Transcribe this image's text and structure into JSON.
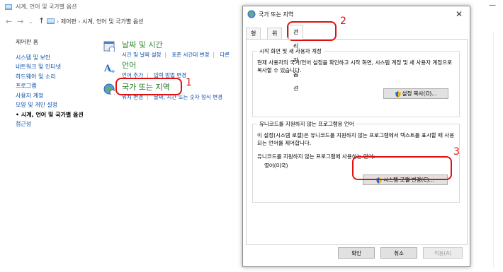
{
  "window_title": "시계, 언어 및 국가별 옵션",
  "breadcrumb": [
    "제어판",
    "시계, 언어 및 국가별 옵션"
  ],
  "sidebar": {
    "home": "제어판 홈",
    "items": [
      "시스템 및 보안",
      "네트워크 및 인터넷",
      "하드웨어 및 소리",
      "프로그램",
      "사용자 계정",
      "모양 및 개인 설정",
      "시계, 언어 및 국가별 옵션",
      "접근성"
    ]
  },
  "categories": [
    {
      "title": "날짜 및 시간",
      "links": [
        "시간 및 날짜 설정",
        "표준 시간대 변경",
        "다른"
      ]
    },
    {
      "title": "언어",
      "links": [
        "언어 추가",
        "입력 방법 변경"
      ]
    },
    {
      "title": "국가 또는 지역",
      "links": [
        "위치 변경",
        "날짜, 시간 또는 숫자 형식 변경"
      ]
    }
  ],
  "dialog": {
    "title": "국가 또는 지역",
    "tabs": [
      "형식",
      "위치",
      "관리자 옵션"
    ],
    "group1": {
      "legend": "시작 화면 및 새 사용자 계정",
      "text": "현재 사용자의 국가/언어 설정을 확인하고 시작 화면, 시스템 계정 및 새 사용자 계정으로 복사할 수 있습니다.",
      "button": "설정 복사(O)..."
    },
    "group2": {
      "legend": "유니코드를 지원하지 않는 프로그램용 언어",
      "text": "이 설정(시스템 로캘)은 유니코드를 지원하지 않는 프로그램에서 텍스트를 표시할 때 사용되는 언어를 제어합니다.",
      "current_label": "유니코드를 지원하지 않는 프로그램에 사용하는 언어:",
      "current_value": "영어(미국)",
      "button": "시스템 로캘 변경(C)..."
    },
    "ok": "확인",
    "cancel": "취소",
    "apply": "적용(A)"
  },
  "annotations": [
    "1",
    "2",
    "3"
  ],
  "colors": {
    "annotation": "#e01010",
    "link": "#0b4fa8",
    "category": "#2f8c2f"
  }
}
